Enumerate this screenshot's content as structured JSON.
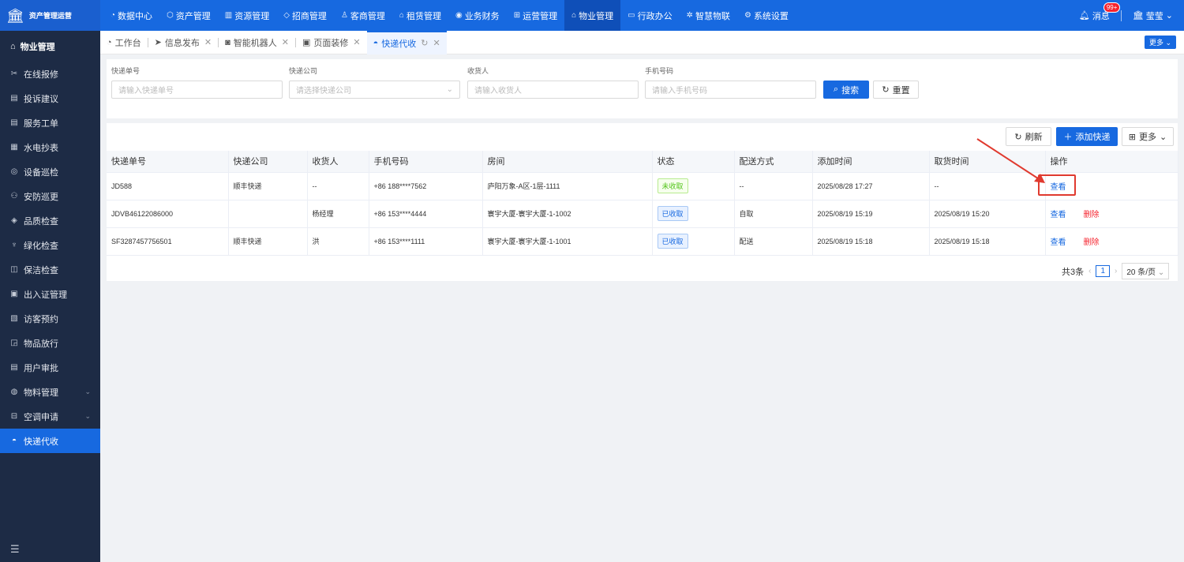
{
  "app": {
    "title": "资产管理运营"
  },
  "topnav": [
    {
      "icon": "◔",
      "label": "数据中心"
    },
    {
      "icon": "⬡",
      "label": "资产管理"
    },
    {
      "icon": "▥",
      "label": "资源管理"
    },
    {
      "icon": "◇",
      "label": "招商管理"
    },
    {
      "icon": "♙",
      "label": "客商管理"
    },
    {
      "icon": "⌂",
      "label": "租赁管理"
    },
    {
      "icon": "◉",
      "label": "业务财务"
    },
    {
      "icon": "⊞",
      "label": "运营管理"
    },
    {
      "icon": "⌂",
      "label": "物业管理"
    },
    {
      "icon": "▭",
      "label": "行政办公"
    },
    {
      "icon": "✲",
      "label": "智慧物联"
    },
    {
      "icon": "⚙",
      "label": "系统设置"
    }
  ],
  "top_right": {
    "messages_label": "消息",
    "messages_badge": "99+",
    "user_name": "莹莹"
  },
  "sidebar": {
    "header": "物业管理",
    "items": [
      {
        "icon": "✂",
        "label": "在线报修"
      },
      {
        "icon": "▤",
        "label": "投诉建议"
      },
      {
        "icon": "▤",
        "label": "服务工单"
      },
      {
        "icon": "▦",
        "label": "水电抄表"
      },
      {
        "icon": "◎",
        "label": "设备巡检"
      },
      {
        "icon": "⚇",
        "label": "安防巡更"
      },
      {
        "icon": "◈",
        "label": "品质检查"
      },
      {
        "icon": "♆",
        "label": "绿化检查"
      },
      {
        "icon": "◫",
        "label": "保洁检查"
      },
      {
        "icon": "▣",
        "label": "出入证管理"
      },
      {
        "icon": "▧",
        "label": "访客预约"
      },
      {
        "icon": "◲",
        "label": "物品放行"
      },
      {
        "icon": "▤",
        "label": "用户审批"
      },
      {
        "icon": "◍",
        "label": "物料管理",
        "arrow": "⌄"
      },
      {
        "icon": "⊟",
        "label": "空调申请",
        "arrow": "⌄"
      },
      {
        "icon": "◓",
        "label": "快递代收"
      }
    ],
    "collapse_icon": "☰"
  },
  "tabs": [
    {
      "icon": "◔",
      "label": "工作台"
    },
    {
      "icon": "➤",
      "label": "信息发布"
    },
    {
      "icon": "◙",
      "label": "智能机器人"
    },
    {
      "icon": "▣",
      "label": "页面装修"
    },
    {
      "icon": "◓",
      "label": "快递代收"
    }
  ],
  "tabs_more": "更多 ⌄",
  "search": {
    "fields": [
      {
        "label": "快递单号",
        "placeholder": "请输入快递单号"
      },
      {
        "label": "快递公司",
        "placeholder": "请选择快递公司"
      },
      {
        "label": "收货人",
        "placeholder": "请输入收货人"
      },
      {
        "label": "手机号码",
        "placeholder": "请输入手机号码"
      }
    ],
    "search_label": "搜索",
    "reset_label": "重置"
  },
  "toolbar": {
    "refresh_label": "刷新",
    "add_label": "添加快递",
    "more_label": "更多"
  },
  "table": {
    "columns": [
      "快递单号",
      "快递公司",
      "收货人",
      "手机号码",
      "房间",
      "状态",
      "配送方式",
      "添加时间",
      "取货时间",
      "操作"
    ],
    "rows": [
      {
        "tracking": "JD588",
        "company": "顺丰快递",
        "recipient": "--",
        "phone": "+86 188****7562",
        "room": "庐阳万象-A区-1层-1111",
        "status": "未收取",
        "delivery": "--",
        "added": "2025/08/28 17:27",
        "picked": "--",
        "view": "查看",
        "delete": ""
      },
      {
        "tracking": "JDVB46122086000",
        "company": "",
        "recipient": "杨经理",
        "phone": "+86 153****4444",
        "room": "寰宇大厦-寰宇大厦-1-1002",
        "status": "已收取",
        "delivery": "自取",
        "added": "2025/08/19 15:19",
        "picked": "2025/08/19 15:20",
        "view": "查看",
        "delete": "删除"
      },
      {
        "tracking": "SF3287457756501",
        "company": "顺丰快递",
        "recipient": "洪",
        "phone": "+86 153****1111",
        "room": "寰宇大厦-寰宇大厦-1-1001",
        "status": "已收取",
        "delivery": "配送",
        "added": "2025/08/19 15:18",
        "picked": "2025/08/19 15:18",
        "view": "查看",
        "delete": "删除"
      }
    ]
  },
  "pagination": {
    "total": "共3条",
    "current": "1",
    "page_size": "20 条/页"
  },
  "colors": {
    "primary": "#1769e0",
    "sidebar_bg": "#1d2b45",
    "danger": "#f5222d",
    "success": "#52c41a",
    "annotation": "#e03a2f"
  }
}
